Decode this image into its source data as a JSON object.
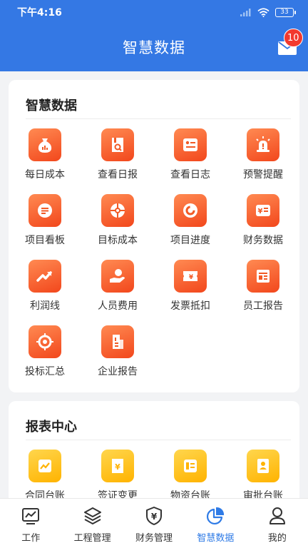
{
  "status_bar": {
    "time": "下午4:16",
    "battery": "33"
  },
  "header": {
    "title": "智慧数据",
    "badge": "10"
  },
  "colors": {
    "primary": "#3478e4",
    "icon_orange": "#f2471c",
    "icon_yellow": "#ffb300",
    "badge": "#f2392e"
  },
  "section1": {
    "title": "智慧数据",
    "items": [
      {
        "label": "每日成本",
        "icon": "money-bag-icon"
      },
      {
        "label": "查看日报",
        "icon": "report-search-icon"
      },
      {
        "label": "查看日志",
        "icon": "log-icon"
      },
      {
        "label": "预警提醒",
        "icon": "alarm-icon"
      },
      {
        "label": "项目看板",
        "icon": "board-icon"
      },
      {
        "label": "目标成本",
        "icon": "target-icon"
      },
      {
        "label": "项目进度",
        "icon": "progress-icon"
      },
      {
        "label": "财务数据",
        "icon": "finance-icon"
      },
      {
        "label": "利润线",
        "icon": "trend-icon"
      },
      {
        "label": "人员费用",
        "icon": "hand-coin-icon"
      },
      {
        "label": "发票抵扣",
        "icon": "invoice-icon"
      },
      {
        "label": "员工报告",
        "icon": "staff-report-icon"
      },
      {
        "label": "投标汇总",
        "icon": "bid-icon"
      },
      {
        "label": "企业报告",
        "icon": "company-icon"
      }
    ]
  },
  "section2": {
    "title": "报表中心",
    "items": [
      {
        "label": "合同台账",
        "icon": "contract-icon"
      },
      {
        "label": "签证变更",
        "icon": "visa-icon"
      },
      {
        "label": "物资台账",
        "icon": "material-icon"
      },
      {
        "label": "审批台账",
        "icon": "approval-icon"
      }
    ]
  },
  "tabs": [
    {
      "label": "工作",
      "icon": "work-chart-icon",
      "active": false
    },
    {
      "label": "工程管理",
      "icon": "layers-icon",
      "active": false
    },
    {
      "label": "财务管理",
      "icon": "yen-shield-icon",
      "active": false
    },
    {
      "label": "智慧数据",
      "icon": "pie-chart-icon",
      "active": true
    },
    {
      "label": "我的",
      "icon": "user-icon",
      "active": false
    }
  ]
}
